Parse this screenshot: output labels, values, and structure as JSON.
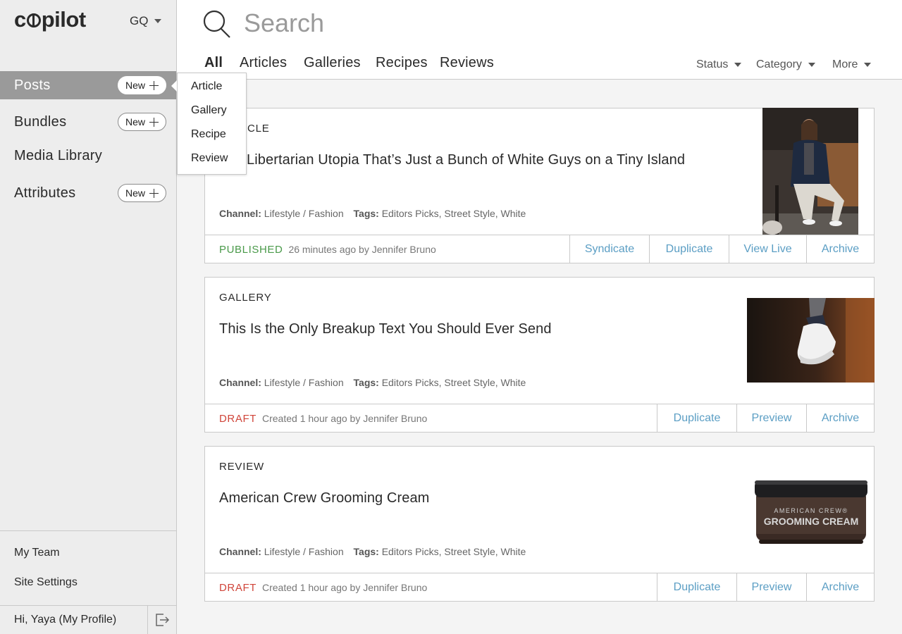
{
  "colors": {
    "published": "#4a9a4a",
    "draft": "#d0453a",
    "link": "#5b9ec4",
    "active_nav": "#9a9a9a"
  },
  "sidebar": {
    "logo": "copilot",
    "brand": "GQ",
    "items": [
      {
        "label": "Posts",
        "new_label": "New"
      },
      {
        "label": "Bundles",
        "new_label": "New"
      },
      {
        "label": "Media Library"
      },
      {
        "label": "Attributes",
        "new_label": "New"
      }
    ],
    "bottom": {
      "team": "My Team",
      "settings": "Site Settings",
      "profile": "Hi, Yaya (My Profile)"
    }
  },
  "new_menu": [
    "Article",
    "Gallery",
    "Recipe",
    "Review"
  ],
  "search": {
    "placeholder": "Search"
  },
  "tabs": [
    "All",
    "Articles",
    "Galleries",
    "Recipes",
    "Reviews"
  ],
  "filters": [
    "Status",
    "Category",
    "More"
  ],
  "cards": [
    {
      "type": "ARTICLE",
      "type_visible": "CLE",
      "title": "A Libertarian Utopia That’s Just a Bunch of White Guys on a Tiny Island",
      "title_visible": "Libertarian Utopia That’s Just a Bunch of White Guys on a Tiny Island",
      "channel_label": "Channel:",
      "channel": "Lifestyle / Fashion",
      "tags_label": "Tags:",
      "tags": "Editors Picks, Street Style, White",
      "status": "PUBLISHED",
      "status_info": "26 minutes ago by Jennifer Bruno",
      "actions": [
        "Syndicate",
        "Duplicate",
        "View Live",
        "Archive"
      ]
    },
    {
      "type": "GALLERY",
      "title": "This Is the Only Breakup Text You Should Ever Send",
      "channel_label": "Channel:",
      "channel": "Lifestyle / Fashion",
      "tags_label": "Tags:",
      "tags": "Editors Picks, Street Style, White",
      "status": "DRAFT",
      "status_info": "Created 1 hour ago by Jennifer Bruno",
      "actions": [
        "Duplicate",
        "Preview",
        "Archive"
      ]
    },
    {
      "type": "REVIEW",
      "title": "American Crew Grooming Cream",
      "channel_label": "Channel:",
      "channel": "Lifestyle / Fashion",
      "tags_label": "Tags:",
      "tags": "Editors Picks, Street Style, White",
      "status": "DRAFT",
      "status_info": "Created 1 hour ago by Jennifer Bruno",
      "actions": [
        "Duplicate",
        "Preview",
        "Archive"
      ],
      "product_brand": "AMERICAN CREW®",
      "product_name": "GROOMING CREAM"
    }
  ]
}
